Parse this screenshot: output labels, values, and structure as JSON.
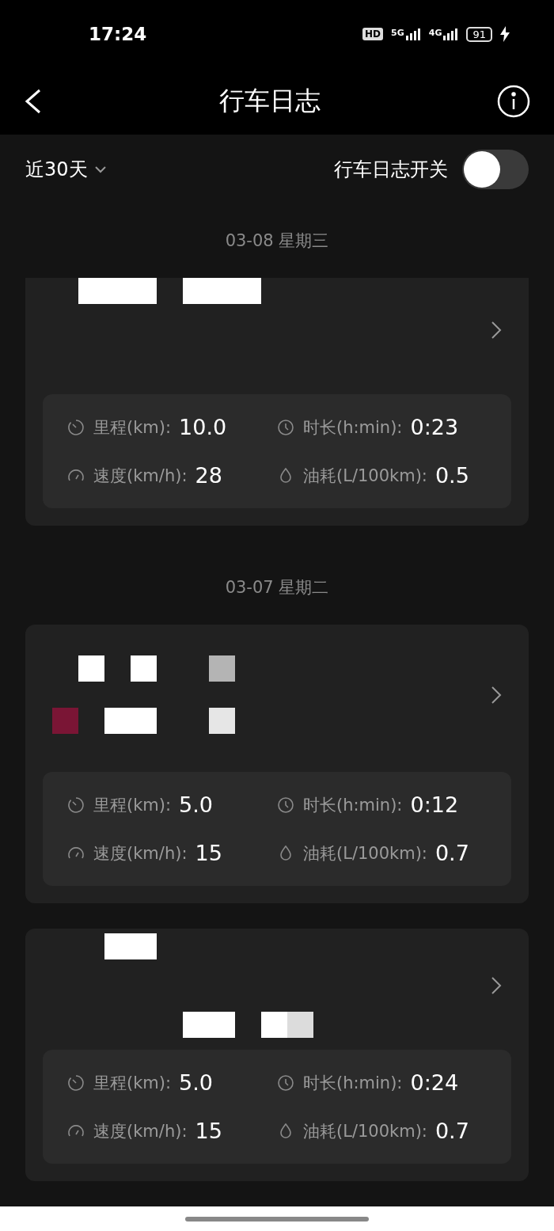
{
  "status_bar": {
    "time": "17:24",
    "hd_badge": "HD",
    "network_1": "5G",
    "network_2": "4G",
    "battery": "91",
    "charging": true
  },
  "header": {
    "title": "行车日志"
  },
  "filter": {
    "range": "近30天",
    "switch_label": "行车日志开关",
    "switch_on": false
  },
  "sections": [
    {
      "date": "03-08 星期三",
      "cards": [
        {
          "cut_top": true,
          "route": [
            {
              "kind": "line",
              "blocks": [
                {
                  "kind": "space"
                },
                {
                  "kind": "long",
                  "color": "#ffffff"
                },
                {
                  "kind": "space"
                },
                {
                  "kind": "long",
                  "color": "#ffffff"
                }
              ]
            },
            {
              "kind": "blank"
            },
            {
              "kind": "blank"
            },
            {
              "kind": "blank"
            }
          ],
          "stats": [
            {
              "kind": "distance",
              "label": "里程(km):",
              "value": "10.0"
            },
            {
              "kind": "duration",
              "label": "时长(h:min):",
              "value": "0:23"
            },
            {
              "kind": "speed",
              "label": "速度(km/h):",
              "value": "28"
            },
            {
              "kind": "fuel",
              "label": "油耗(L/100km):",
              "value": "0.5"
            }
          ]
        }
      ]
    },
    {
      "date": "03-07 星期二",
      "cards": [
        {
          "cut_top": false,
          "route": [
            {
              "kind": "blank"
            },
            {
              "kind": "line",
              "blocks": [
                {
                  "kind": "space"
                },
                {
                  "kind": "square",
                  "color": "#ffffff"
                },
                {
                  "kind": "space"
                },
                {
                  "kind": "square",
                  "color": "#ffffff"
                },
                {
                  "kind": "space"
                },
                {
                  "kind": "space"
                },
                {
                  "kind": "square",
                  "color": "#b4b4b4"
                }
              ]
            },
            {
              "kind": "blank"
            },
            {
              "kind": "line",
              "blocks": [
                {
                  "kind": "square",
                  "color": "#7a1535"
                },
                {
                  "kind": "space"
                },
                {
                  "kind": "wide",
                  "color": "#ffffff"
                },
                {
                  "kind": "space"
                },
                {
                  "kind": "space"
                },
                {
                  "kind": "square",
                  "color": "#e6e6e6"
                }
              ]
            },
            {
              "kind": "blank"
            }
          ],
          "stats": [
            {
              "kind": "distance",
              "label": "里程(km):",
              "value": "5.0"
            },
            {
              "kind": "duration",
              "label": "时长(h:min):",
              "value": "0:12"
            },
            {
              "kind": "speed",
              "label": "速度(km/h):",
              "value": "15"
            },
            {
              "kind": "fuel",
              "label": "油耗(L/100km):",
              "value": "0.7"
            }
          ]
        },
        {
          "cut_top": false,
          "route": [
            {
              "kind": "line",
              "blocks": [
                {
                  "kind": "space"
                },
                {
                  "kind": "space"
                },
                {
                  "kind": "wide",
                  "color": "#ffffff"
                }
              ]
            },
            {
              "kind": "blank"
            },
            {
              "kind": "blank"
            },
            {
              "kind": "line",
              "blocks": [
                {
                  "kind": "space"
                },
                {
                  "kind": "space"
                },
                {
                  "kind": "space"
                },
                {
                  "kind": "space"
                },
                {
                  "kind": "space"
                },
                {
                  "kind": "wide",
                  "color": "#ffffff"
                },
                {
                  "kind": "space"
                },
                {
                  "kind": "square",
                  "color": "#ffffff"
                },
                {
                  "kind": "square",
                  "color": "#dcdcdc"
                }
              ]
            }
          ],
          "stats": [
            {
              "kind": "distance",
              "label": "里程(km):",
              "value": "5.0"
            },
            {
              "kind": "duration",
              "label": "时长(h:min):",
              "value": "0:24"
            },
            {
              "kind": "speed",
              "label": "速度(km/h):",
              "value": "15"
            },
            {
              "kind": "fuel",
              "label": "油耗(L/100km):",
              "value": "0.7"
            }
          ]
        }
      ]
    }
  ]
}
